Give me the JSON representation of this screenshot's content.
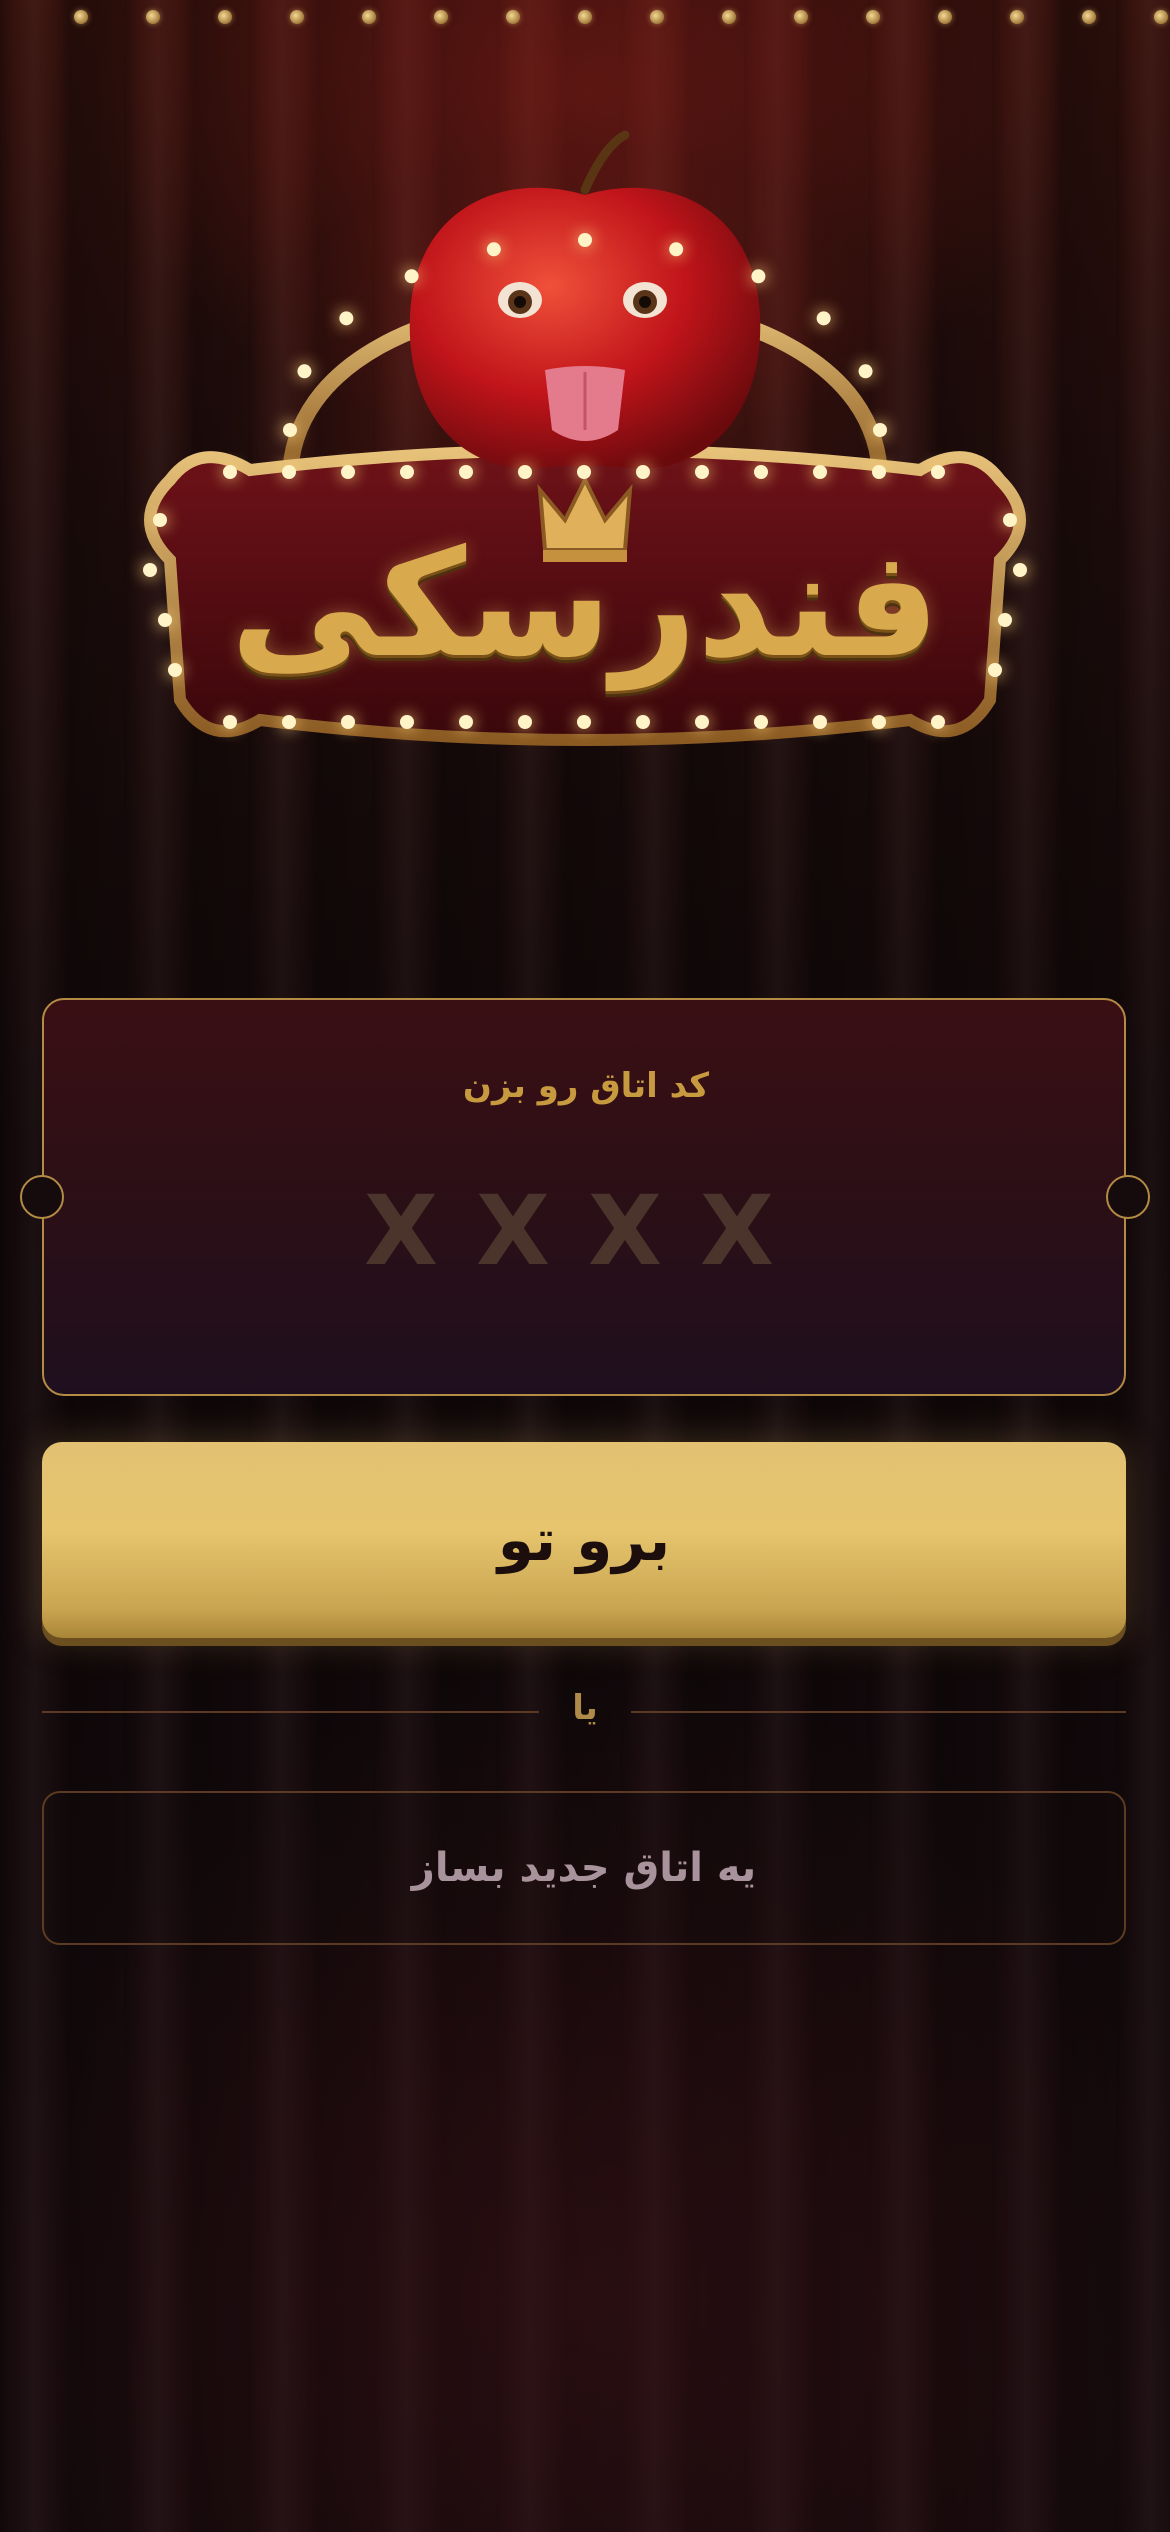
{
  "logo": {
    "title": "فندرسکی",
    "icons": [
      "apple-mascot-icon",
      "crown-icon",
      "marquee-lights-icon"
    ]
  },
  "join_card": {
    "label": "کد اتاق رو بزن",
    "code_placeholder": "XXXX"
  },
  "enter_button": {
    "label": "برو تو"
  },
  "divider": {
    "text": "یا"
  },
  "create_room_button": {
    "label": "یه اتاق جدید بساز"
  },
  "colors": {
    "gold": "#d9a94e",
    "button_gold": "#e2c272",
    "card_border": "#b48b45",
    "background": "#160a0d"
  }
}
